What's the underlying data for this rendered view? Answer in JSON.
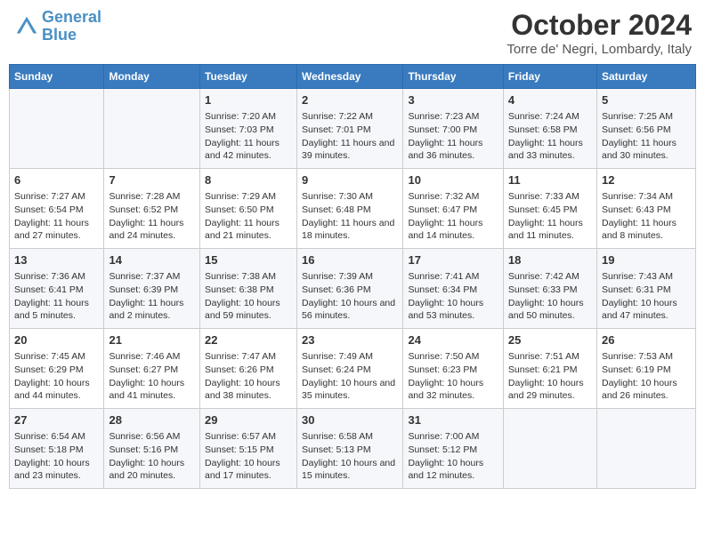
{
  "header": {
    "logo_line1": "General",
    "logo_line2": "Blue",
    "month": "October 2024",
    "location": "Torre de' Negri, Lombardy, Italy"
  },
  "days_of_week": [
    "Sunday",
    "Monday",
    "Tuesday",
    "Wednesday",
    "Thursday",
    "Friday",
    "Saturday"
  ],
  "weeks": [
    [
      {
        "day": "",
        "info": ""
      },
      {
        "day": "",
        "info": ""
      },
      {
        "day": "1",
        "info": "Sunrise: 7:20 AM\nSunset: 7:03 PM\nDaylight: 11 hours and 42 minutes."
      },
      {
        "day": "2",
        "info": "Sunrise: 7:22 AM\nSunset: 7:01 PM\nDaylight: 11 hours and 39 minutes."
      },
      {
        "day": "3",
        "info": "Sunrise: 7:23 AM\nSunset: 7:00 PM\nDaylight: 11 hours and 36 minutes."
      },
      {
        "day": "4",
        "info": "Sunrise: 7:24 AM\nSunset: 6:58 PM\nDaylight: 11 hours and 33 minutes."
      },
      {
        "day": "5",
        "info": "Sunrise: 7:25 AM\nSunset: 6:56 PM\nDaylight: 11 hours and 30 minutes."
      }
    ],
    [
      {
        "day": "6",
        "info": "Sunrise: 7:27 AM\nSunset: 6:54 PM\nDaylight: 11 hours and 27 minutes."
      },
      {
        "day": "7",
        "info": "Sunrise: 7:28 AM\nSunset: 6:52 PM\nDaylight: 11 hours and 24 minutes."
      },
      {
        "day": "8",
        "info": "Sunrise: 7:29 AM\nSunset: 6:50 PM\nDaylight: 11 hours and 21 minutes."
      },
      {
        "day": "9",
        "info": "Sunrise: 7:30 AM\nSunset: 6:48 PM\nDaylight: 11 hours and 18 minutes."
      },
      {
        "day": "10",
        "info": "Sunrise: 7:32 AM\nSunset: 6:47 PM\nDaylight: 11 hours and 14 minutes."
      },
      {
        "day": "11",
        "info": "Sunrise: 7:33 AM\nSunset: 6:45 PM\nDaylight: 11 hours and 11 minutes."
      },
      {
        "day": "12",
        "info": "Sunrise: 7:34 AM\nSunset: 6:43 PM\nDaylight: 11 hours and 8 minutes."
      }
    ],
    [
      {
        "day": "13",
        "info": "Sunrise: 7:36 AM\nSunset: 6:41 PM\nDaylight: 11 hours and 5 minutes."
      },
      {
        "day": "14",
        "info": "Sunrise: 7:37 AM\nSunset: 6:39 PM\nDaylight: 11 hours and 2 minutes."
      },
      {
        "day": "15",
        "info": "Sunrise: 7:38 AM\nSunset: 6:38 PM\nDaylight: 10 hours and 59 minutes."
      },
      {
        "day": "16",
        "info": "Sunrise: 7:39 AM\nSunset: 6:36 PM\nDaylight: 10 hours and 56 minutes."
      },
      {
        "day": "17",
        "info": "Sunrise: 7:41 AM\nSunset: 6:34 PM\nDaylight: 10 hours and 53 minutes."
      },
      {
        "day": "18",
        "info": "Sunrise: 7:42 AM\nSunset: 6:33 PM\nDaylight: 10 hours and 50 minutes."
      },
      {
        "day": "19",
        "info": "Sunrise: 7:43 AM\nSunset: 6:31 PM\nDaylight: 10 hours and 47 minutes."
      }
    ],
    [
      {
        "day": "20",
        "info": "Sunrise: 7:45 AM\nSunset: 6:29 PM\nDaylight: 10 hours and 44 minutes."
      },
      {
        "day": "21",
        "info": "Sunrise: 7:46 AM\nSunset: 6:27 PM\nDaylight: 10 hours and 41 minutes."
      },
      {
        "day": "22",
        "info": "Sunrise: 7:47 AM\nSunset: 6:26 PM\nDaylight: 10 hours and 38 minutes."
      },
      {
        "day": "23",
        "info": "Sunrise: 7:49 AM\nSunset: 6:24 PM\nDaylight: 10 hours and 35 minutes."
      },
      {
        "day": "24",
        "info": "Sunrise: 7:50 AM\nSunset: 6:23 PM\nDaylight: 10 hours and 32 minutes."
      },
      {
        "day": "25",
        "info": "Sunrise: 7:51 AM\nSunset: 6:21 PM\nDaylight: 10 hours and 29 minutes."
      },
      {
        "day": "26",
        "info": "Sunrise: 7:53 AM\nSunset: 6:19 PM\nDaylight: 10 hours and 26 minutes."
      }
    ],
    [
      {
        "day": "27",
        "info": "Sunrise: 6:54 AM\nSunset: 5:18 PM\nDaylight: 10 hours and 23 minutes."
      },
      {
        "day": "28",
        "info": "Sunrise: 6:56 AM\nSunset: 5:16 PM\nDaylight: 10 hours and 20 minutes."
      },
      {
        "day": "29",
        "info": "Sunrise: 6:57 AM\nSunset: 5:15 PM\nDaylight: 10 hours and 17 minutes."
      },
      {
        "day": "30",
        "info": "Sunrise: 6:58 AM\nSunset: 5:13 PM\nDaylight: 10 hours and 15 minutes."
      },
      {
        "day": "31",
        "info": "Sunrise: 7:00 AM\nSunset: 5:12 PM\nDaylight: 10 hours and 12 minutes."
      },
      {
        "day": "",
        "info": ""
      },
      {
        "day": "",
        "info": ""
      }
    ]
  ]
}
